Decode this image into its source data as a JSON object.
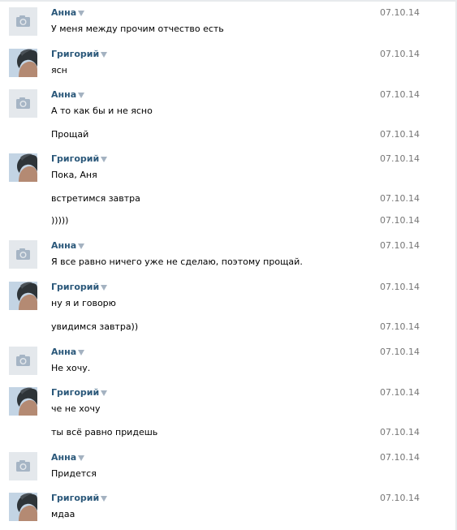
{
  "messages": [
    {
      "author": "Анна",
      "avatar": "camera-icon",
      "text": "У меня между прочим отчество есть",
      "date": "07.10.14"
    },
    {
      "author": "Григорий",
      "avatar": "user-photo",
      "text": "ясн",
      "date": "07.10.14"
    },
    {
      "author": "Анна",
      "avatar": "camera-icon",
      "text": "А то как бы и не ясно",
      "date": "07.10.14"
    },
    {
      "text": "Прощай",
      "date": "07.10.14"
    },
    {
      "author": "Григорий",
      "avatar": "user-photo",
      "text": "Пока, Аня",
      "date": "07.10.14"
    },
    {
      "text": "встретимся завтра",
      "date": "07.10.14"
    },
    {
      "text": ")))))",
      "date": "07.10.14"
    },
    {
      "author": "Анна",
      "avatar": "camera-icon",
      "text": "Я все равно ничего уже не сделаю, поэтому прощай.",
      "date": "07.10.14"
    },
    {
      "author": "Григорий",
      "avatar": "user-photo",
      "text": "ну я и говорю",
      "date": "07.10.14"
    },
    {
      "text": "увидимся завтра))",
      "date": "07.10.14"
    },
    {
      "author": "Анна",
      "avatar": "camera-icon",
      "text": "Не хочу.",
      "date": "07.10.14"
    },
    {
      "author": "Григорий",
      "avatar": "user-photo",
      "text": "че не хочу",
      "date": "07.10.14"
    },
    {
      "text": "ты всё равно придешь",
      "date": "07.10.14"
    },
    {
      "author": "Анна",
      "avatar": "camera-icon",
      "text": "Придется",
      "date": "07.10.14"
    },
    {
      "author": "Григорий",
      "avatar": "user-photo",
      "text": "мдаа",
      "date": "07.10.14"
    }
  ],
  "colors": {
    "author_link": "#2b587a",
    "date": "#777777",
    "camera_bg": "#e4e8ec"
  },
  "icons": {
    "menu": "chevron-down-icon"
  }
}
